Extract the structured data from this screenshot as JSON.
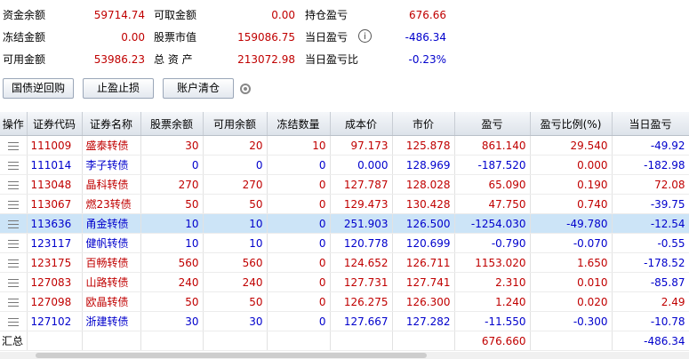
{
  "summary": {
    "fund_balance_label": "资金余额",
    "fund_balance": "59714.74",
    "withdrawable_label": "可取金额",
    "withdrawable": "0.00",
    "position_pnl_label": "持仓盈亏",
    "position_pnl": "676.66",
    "frozen_label": "冻结金额",
    "frozen": "0.00",
    "market_value_label": "股票市值",
    "market_value": "159086.75",
    "daily_pnl_label": "当日盈亏",
    "daily_pnl": "-486.34",
    "available_label": "可用金额",
    "available": "53986.23",
    "total_assets_label": "总 资 产",
    "total_assets": "213072.98",
    "daily_pnl_ratio_label": "当日盈亏比",
    "daily_pnl_ratio": "-0.23%",
    "info_icon": "i"
  },
  "toolbar": {
    "repo_label": "国债逆回购",
    "stop_label": "止盈止损",
    "clear_label": "账户清仓",
    "settings_icon": "gear-icon"
  },
  "table": {
    "headers": [
      "操作",
      "证券代码",
      "证券名称",
      "股票余额",
      "可用余额",
      "冻结数量",
      "成本价",
      "市价",
      "盈亏",
      "盈亏比例(%)",
      "当日盈亏"
    ],
    "rows": [
      {
        "code": "111009",
        "name": "盛泰转债",
        "balance": "30",
        "available": "20",
        "frozen": "10",
        "cost": "97.173",
        "price": "125.878",
        "pnl": "861.140",
        "pnl_ratio": "29.540",
        "daily_pnl": "-49.92"
      },
      {
        "code": "111014",
        "name": "李子转债",
        "balance": "0",
        "available": "0",
        "frozen": "0",
        "cost": "0.000",
        "price": "128.969",
        "pnl": "-187.520",
        "pnl_ratio": "0.000",
        "daily_pnl": "-182.98"
      },
      {
        "code": "113048",
        "name": "晶科转债",
        "balance": "270",
        "available": "270",
        "frozen": "0",
        "cost": "127.787",
        "price": "128.028",
        "pnl": "65.090",
        "pnl_ratio": "0.190",
        "daily_pnl": "72.08"
      },
      {
        "code": "113067",
        "name": "燃23转债",
        "balance": "50",
        "available": "50",
        "frozen": "0",
        "cost": "129.473",
        "price": "130.428",
        "pnl": "47.750",
        "pnl_ratio": "0.740",
        "daily_pnl": "-39.75"
      },
      {
        "code": "113636",
        "name": "甬金转债",
        "balance": "10",
        "available": "10",
        "frozen": "0",
        "cost": "251.903",
        "price": "126.500",
        "pnl": "-1254.030",
        "pnl_ratio": "-49.780",
        "daily_pnl": "-12.54"
      },
      {
        "code": "123117",
        "name": "健帆转债",
        "balance": "10",
        "available": "10",
        "frozen": "0",
        "cost": "120.778",
        "price": "120.699",
        "pnl": "-0.790",
        "pnl_ratio": "-0.070",
        "daily_pnl": "-0.55"
      },
      {
        "code": "123175",
        "name": "百畅转债",
        "balance": "560",
        "available": "560",
        "frozen": "0",
        "cost": "124.652",
        "price": "126.711",
        "pnl": "1153.020",
        "pnl_ratio": "1.650",
        "daily_pnl": "-178.52"
      },
      {
        "code": "127083",
        "name": "山路转债",
        "balance": "240",
        "available": "240",
        "frozen": "0",
        "cost": "127.731",
        "price": "127.741",
        "pnl": "2.310",
        "pnl_ratio": "0.010",
        "daily_pnl": "-85.87"
      },
      {
        "code": "127098",
        "name": "欧晶转债",
        "balance": "50",
        "available": "50",
        "frozen": "0",
        "cost": "126.275",
        "price": "126.300",
        "pnl": "1.240",
        "pnl_ratio": "0.020",
        "daily_pnl": "2.49"
      },
      {
        "code": "127102",
        "name": "浙建转债",
        "balance": "30",
        "available": "30",
        "frozen": "0",
        "cost": "127.667",
        "price": "127.282",
        "pnl": "-11.550",
        "pnl_ratio": "-0.300",
        "daily_pnl": "-10.78"
      }
    ],
    "total": {
      "label": "汇总",
      "pnl": "676.660",
      "daily_pnl": "-486.34"
    }
  },
  "colors": {
    "positive": "#c00000",
    "negative": "#0000cc",
    "selected_row": "#cce4f7"
  }
}
